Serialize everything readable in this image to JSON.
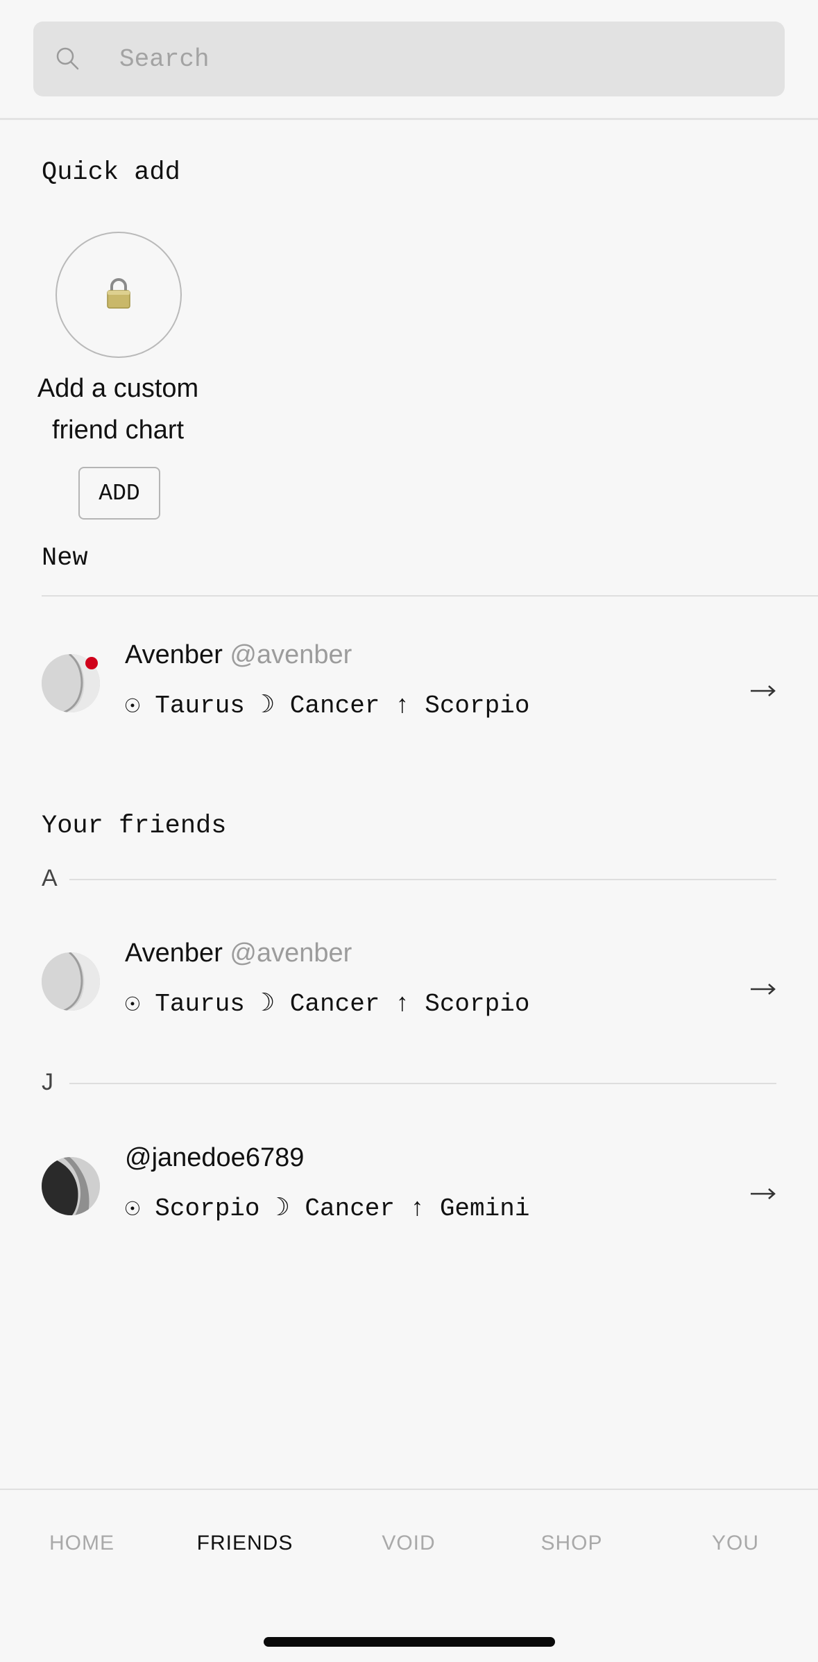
{
  "search": {
    "placeholder": "Search"
  },
  "quick_add": {
    "title": "Quick add",
    "card_text_line1": "Add a custom",
    "card_text_line2": "friend chart",
    "button_label": "ADD",
    "icon": "lock-icon"
  },
  "new_section": {
    "title": "New",
    "items": [
      {
        "name": "Avenber",
        "handle": "@avenber",
        "signs": "☉ Taurus ☽ Cancer ↑ Scorpio",
        "unread": true
      }
    ]
  },
  "friends_section": {
    "title": "Your friends",
    "groups": [
      {
        "letter": "A",
        "items": [
          {
            "name": "Avenber",
            "handle": "@avenber",
            "signs": "☉ Taurus ☽ Cancer ↑ Scorpio"
          }
        ]
      },
      {
        "letter": "J",
        "items": [
          {
            "name": "",
            "handle": "@janedoe6789",
            "signs": "☉ Scorpio ☽ Cancer ↑ Gemini"
          }
        ]
      }
    ]
  },
  "tabs": [
    {
      "label": "HOME",
      "active": false
    },
    {
      "label": "FRIENDS",
      "active": true
    },
    {
      "label": "VOID",
      "active": false
    },
    {
      "label": "SHOP",
      "active": false
    },
    {
      "label": "YOU",
      "active": false
    }
  ],
  "colors": {
    "unread_dot": "#d0021b",
    "background": "#f7f7f7",
    "search_bg": "#e2e2e2"
  }
}
